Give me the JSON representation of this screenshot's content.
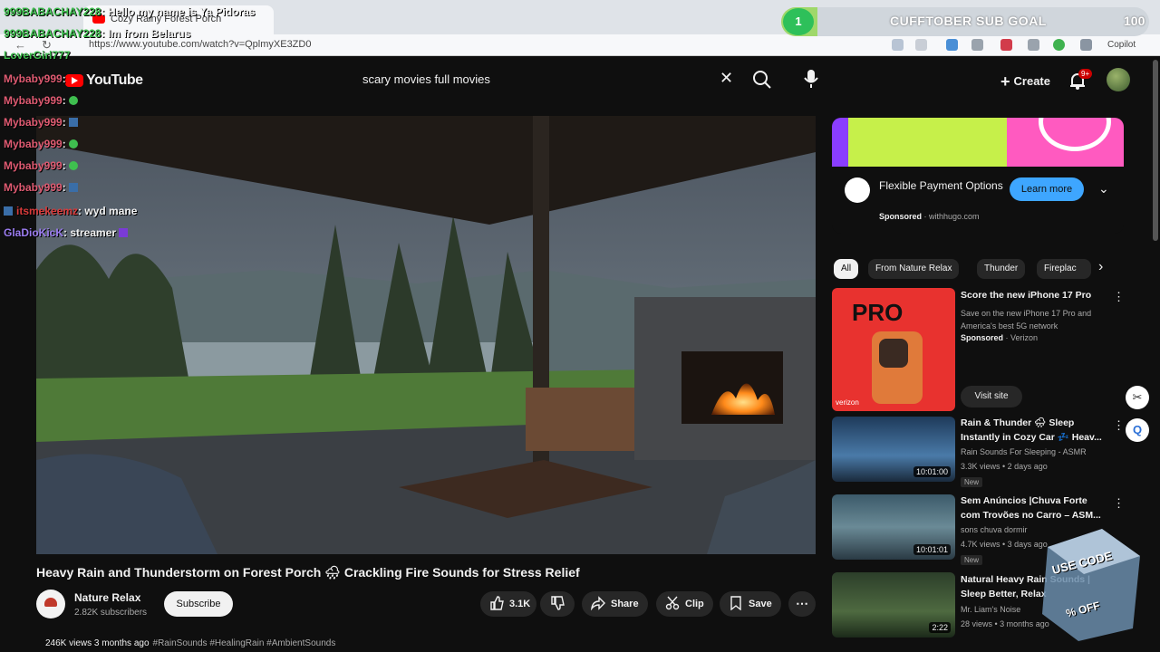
{
  "browser": {
    "tab_title": "Cozy Rainy Forest Porch",
    "url": "https://www.youtube.com/watch?v=QplmyXE3ZD0",
    "copilot_label": "Copilot"
  },
  "header": {
    "logo_text": "YouTube",
    "search_query": "scary movies full movies",
    "create_label": "Create",
    "notification_badge": "9+"
  },
  "video": {
    "title": "Heavy Rain and Thunderstorm on Forest Porch 🌧 Crackling Fire Sounds for Stress Relief",
    "channel_name": "Nature Relax",
    "subscribers": "2.82K subscribers",
    "subscribe_label": "Subscribe",
    "likes": "3.1K",
    "share_label": "Share",
    "clip_label": "Clip",
    "save_label": "Save",
    "views_date": "246K views  3 months ago",
    "hashtags": "#RainSounds #HealingRain #AmbientSounds"
  },
  "ad": {
    "title": "Flexible Payment Options",
    "sponsored": "Sponsored",
    "domain": " · withhugo.com",
    "cta": "Learn more"
  },
  "chips": [
    "All",
    "From Nature Relax",
    "Thunder",
    "Fireplac"
  ],
  "recommendations": [
    {
      "title": "Score the new iPhone 17 Pro",
      "desc": "Save on the new iPhone 17 Pro and America's best 5G network",
      "sponsored": "Sponsored",
      "advertiser": " · Verizon",
      "cta": "Visit site",
      "thumb_text": "PRO",
      "thumb_brand": "verizon"
    },
    {
      "title": "Rain & Thunder 🌧 Sleep Instantly in Cozy Car 💤 Heav...",
      "channel": "Rain Sounds For Sleeping - ASMR",
      "stats": "3.3K views • 2 days ago",
      "badge": "New",
      "duration": "10:01:00"
    },
    {
      "title": "Sem Anúncios |Chuva Forte com Trovões no Carro – ASM...",
      "channel": "sons chuva dormir",
      "stats": "4.7K views • 3 days ago",
      "badge": "New",
      "duration": "10:01:01"
    },
    {
      "title": "Natural Heavy Rain Sounds | Sleep Better, Relax",
      "channel": "Mr. Liam's Noise",
      "stats": "28 views • 3 months ago",
      "duration": "2:22"
    }
  ],
  "stream_overlay": {
    "chat": [
      {
        "name": "999BABACHAY228",
        "msg": ": Hello my name is Ya Pidoras",
        "color": "#3fbf4f"
      },
      {
        "name": "999BABACHAY228",
        "msg": ": Im from Belarus",
        "color": "#3fbf4f"
      },
      {
        "name": "LoverGirl777",
        "msg": "",
        "color": "#3fbf4f"
      },
      {
        "name": "Mybaby999",
        "msg": ":",
        "color": "#e05b72"
      },
      {
        "name": "Mybaby999",
        "msg": ":",
        "color": "#e05b72"
      },
      {
        "name": "Mybaby999",
        "msg": ":",
        "color": "#e05b72"
      },
      {
        "name": "Mybaby999",
        "msg": ":",
        "color": "#e05b72"
      },
      {
        "name": "Mybaby999",
        "msg": ":",
        "color": "#e05b72"
      },
      {
        "name": "Mybaby999",
        "msg": ":",
        "color": "#e05b72"
      },
      {
        "name": "itsmekeemz",
        "msg": ": wyd mane",
        "color": "#d93a3a"
      },
      {
        "name": "GlaDioKicK",
        "msg": ": streamer",
        "color": "#9b7cf0"
      }
    ],
    "goal_current": "1",
    "goal_label": "CUFFTOBER SUB GOAL",
    "goal_target": "100",
    "goal_progress": 0.01,
    "promo_text": "USE CODE",
    "promo_sub": "% OFF"
  }
}
